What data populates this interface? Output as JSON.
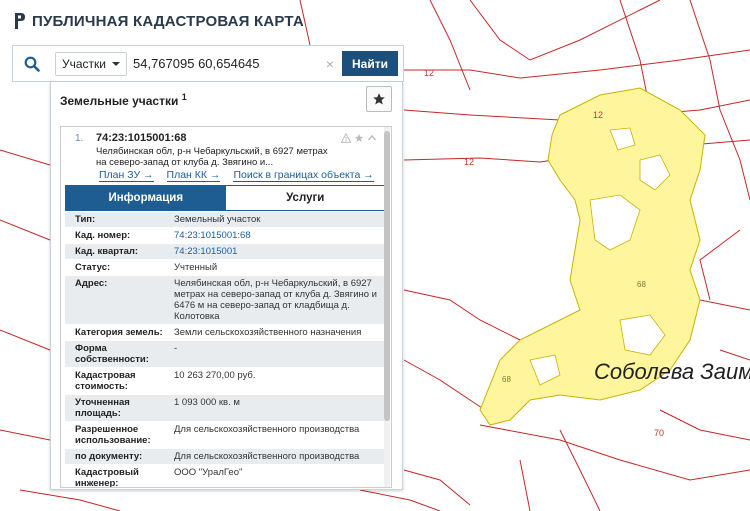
{
  "header": {
    "title": "ПУБЛИЧНАЯ КАДАСТРОВАЯ КАРТА"
  },
  "search": {
    "type_label": "Участки",
    "query": "54,767095 60,654645",
    "clear": "×",
    "find_label": "Найти"
  },
  "panel": {
    "title": "Земельные участки",
    "count": "1"
  },
  "result": {
    "index": "1.",
    "cadastral_id": "74:23:1015001:68",
    "description": "Челябинская обл, р-н Чебаркульский, в 6927 метрах на северо-запад от клуба д. Звягино и...",
    "links": [
      "План ЗУ →",
      "План КК →",
      "Поиск в границах объекта →"
    ],
    "tabs": [
      "Информация",
      "Услуги"
    ]
  },
  "properties": [
    {
      "key": "Тип:",
      "value": "Земельный участок"
    },
    {
      "key": "Кад. номер:",
      "value": "74:23:1015001:68"
    },
    {
      "key": "Кад. квартал:",
      "value": "74:23:1015001"
    },
    {
      "key": "Статус:",
      "value": "Учтенный"
    },
    {
      "key": "Адрес:",
      "value": "Челябинская обл, р-н Чебаркульский, в 6927 метрах на северо-запад от клуба д. Звягино и 6476 м на северо-запад от кладбища д. Колотовка"
    },
    {
      "key": "Категория земель:",
      "value": "Земли сельскохозяйственного назначения"
    },
    {
      "key": "Форма собственности:",
      "value": "-"
    },
    {
      "key": "Кадастровая стоимость:",
      "value": "10 263 270,00 руб."
    },
    {
      "key": "Уточненная площадь:",
      "value": "1 093 000 кв. м"
    },
    {
      "key": "Разрешенное использование:",
      "value": "Для сельскохозяйственного производства"
    },
    {
      "key": "по документу:",
      "value": "Для сельскохозяйственного производства"
    },
    {
      "key": "Кадастровый инженер:",
      "value": "ООО \"УралГео\""
    }
  ],
  "map": {
    "village_name": "Соболева Заим",
    "labels": [
      "12",
      "12",
      "12",
      "68",
      "68",
      "70"
    ]
  },
  "colors": {
    "parcel_fill": "#fff59d",
    "parcel_stroke": "#c9b300",
    "boundary": "#c62828",
    "brand": "#1d4f7d"
  }
}
